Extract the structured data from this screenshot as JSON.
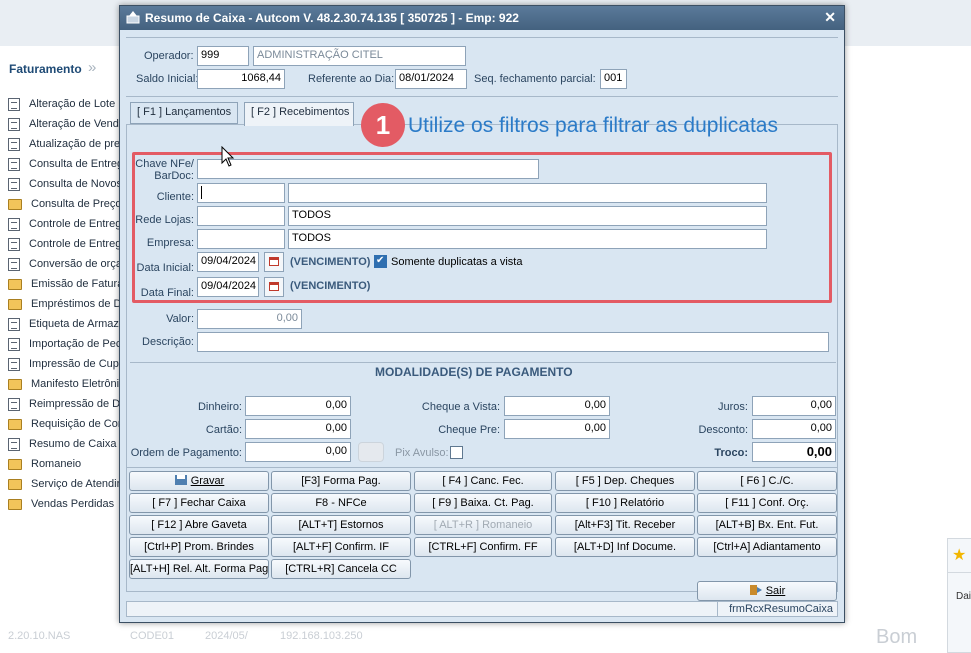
{
  "background": {
    "breadcrumb": "Faturamento",
    "menu": [
      {
        "label": "Alteração de Lote",
        "icon": "document-icon"
      },
      {
        "label": "Alteração de Vend",
        "icon": "document-icon"
      },
      {
        "label": "Atualização de pre",
        "icon": "document-icon"
      },
      {
        "label": "Consulta de Entreg",
        "icon": "document-icon"
      },
      {
        "label": "Consulta de Novos",
        "icon": "document-icon"
      },
      {
        "label": "Consulta de Preços",
        "icon": "folder-icon"
      },
      {
        "label": "Controle de Entreg",
        "icon": "document-icon"
      },
      {
        "label": "Controle de Entreg",
        "icon": "document-icon"
      },
      {
        "label": "Conversão de orça",
        "icon": "document-icon"
      },
      {
        "label": "Emissão de Fatura",
        "icon": "folder-icon"
      },
      {
        "label": "Empréstimos de D",
        "icon": "folder-icon"
      },
      {
        "label": "Etiqueta de Armaz",
        "icon": "document-icon"
      },
      {
        "label": "Importação de Pec",
        "icon": "document-icon"
      },
      {
        "label": "Impressão de Cupo",
        "icon": "document-icon"
      },
      {
        "label": "Manifesto Eletrôni",
        "icon": "folder-icon"
      },
      {
        "label": "Reimpressão de Do",
        "icon": "document-icon"
      },
      {
        "label": "Requisição de Con",
        "icon": "folder-icon"
      },
      {
        "label": "Resumo de Caixa",
        "icon": "document-icon"
      },
      {
        "label": "Romaneio",
        "icon": "folder-icon"
      },
      {
        "label": "Serviço de Atendin",
        "icon": "folder-icon"
      },
      {
        "label": "Vendas Perdidas",
        "icon": "folder-icon"
      }
    ],
    "status": [
      "2.20.10.NAS",
      "CODE01",
      "2024/05/",
      "192.168.103.250",
      "Bom"
    ],
    "right_panel_text": "Dai"
  },
  "dialog": {
    "title": "Resumo de Caixa   -   Autcom V. 48.2.30.74.135 [ 350725 ] - Emp: 922",
    "operador_label": "Operador:",
    "operador_code": "999",
    "operador_name": "ADMINISTRAÇÃO CITEL",
    "saldo_label": "Saldo Inicial:",
    "saldo_value": "1068,44",
    "referente_label": "Referente ao Dia:",
    "referente_value": "08/01/2024",
    "seq_label": "Seq. fechamento parcial:",
    "seq_value": "001",
    "tabs": [
      "[ F1 ] Lançamentos",
      "[ F2 ] Recebimentos"
    ],
    "annotation_number": "1",
    "annotation_text": "Utilize os filtros para filtrar as duplicatas",
    "filters": {
      "chave_label": "Chave NFe/\nBarDoc:",
      "cliente_label": "Cliente:",
      "rede_label": "Rede Lojas:",
      "rede_value": "TODOS",
      "empresa_label": "Empresa:",
      "empresa_value": "TODOS",
      "data_inicial_label": "Data Inicial:",
      "data_inicial_value": "09/04/2024",
      "data_final_label": "Data Final:",
      "data_final_value": "09/04/2024",
      "vencimento": "(VENCIMENTO)",
      "somente_label": "Somente duplicatas a vista"
    },
    "valor_label": "Valor:",
    "valor_value": "0,00",
    "descricao_label": "Descrição:",
    "modalidades_title": "MODALIDADE(S)  DE PAGAMENTO",
    "payment": {
      "dinheiro_label": "Dinheiro:",
      "dinheiro": "0,00",
      "cartao_label": "Cartão:",
      "cartao": "0,00",
      "ordem_label": "Ordem de Pagamento:",
      "ordem": "0,00",
      "cheque_vista_label": "Cheque a Vista:",
      "cheque_vista": "0,00",
      "cheque_pre_label": "Cheque Pre:",
      "cheque_pre": "0,00",
      "pix_label": "Pix Avulso:",
      "juros_label": "Juros:",
      "juros": "0,00",
      "desconto_label": "Desconto:",
      "desconto": "0,00",
      "troco_label": "Troco:",
      "troco": "0,00"
    },
    "buttons": {
      "gravar": "Gravar",
      "f3": "[F3] Forma Pag.",
      "f4": "[ F4 ] Canc. Fec.",
      "f5": "[ F5 ] Dep. Cheques",
      "f6": "[ F6 ] C./C.",
      "f7": "[ F7 ] Fechar Caixa",
      "f8": "F8 - NFCe",
      "f9": "[ F9 ] Baixa. Ct. Pag.",
      "f10": "[ F10 ] Relatório",
      "f11": "[ F11 ] Conf. Orç.",
      "f12": "[ F12 ] Abre Gaveta",
      "alt_t": "[ALT+T] Estornos",
      "alt_r": "[ ALT+R ] Romaneio",
      "alt_f3": "[Alt+F3] Tit. Receber",
      "alt_b": "[ALT+B] Bx. Ent. Fut.",
      "ctrl_p": "[Ctrl+P] Prom. Brindes",
      "alt_f": "[ALT+F] Confirm. IF",
      "ctrl_f": "[CTRL+F] Confirm. FF",
      "alt_d": "[ALT+D] Inf Docume.",
      "ctrl_a": "[Ctrl+A] Adiantamento",
      "alt_h": "[ALT+H] Rel. Alt. Forma Pag.",
      "ctrl_r": "[CTRL+R] Cancela CC",
      "sair": "Sair"
    },
    "form_name": "frmRcxResumoCaixa"
  }
}
